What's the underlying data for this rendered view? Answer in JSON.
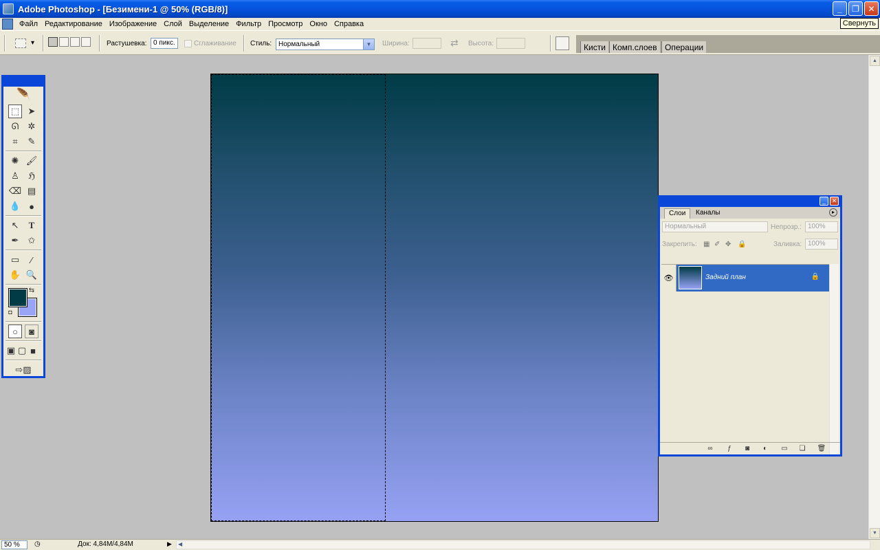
{
  "window": {
    "title": "Adobe Photoshop - [Безимени-1 @ 50% (RGB/8)]",
    "minimize_glyph": "_",
    "restore_glyph": "❐",
    "close_glyph": "✕",
    "tooltip": "Свернуть"
  },
  "menu": [
    "Файл",
    "Редактирование",
    "Изображение",
    "Слой",
    "Выделение",
    "Фильтр",
    "Просмотр",
    "Окно",
    "Справка"
  ],
  "options": {
    "feather_label": "Растушевка:",
    "feather_value": "0 пикс.",
    "antialias_label": "Сглаживание",
    "style_label": "Стиль:",
    "style_value": "Нормальный",
    "width_label": "Ширина:",
    "height_label": "Высота:",
    "swap_glyph": "⇄",
    "palette_tabs": [
      "Кисти",
      "Комп.слоев",
      "Операции"
    ]
  },
  "colors": {
    "foreground": "#003b46",
    "background": "#9aa5f5",
    "selection_highlight": "#316ac5"
  },
  "layers": {
    "tabs": [
      "Слои",
      "Каналы"
    ],
    "menu_glyph": "▸",
    "blend_mode": "Нормальный",
    "opacity_label": "Непрозр.:",
    "opacity_value": "100%",
    "lock_label": "Закрепить:",
    "fill_label": "Заливка:",
    "fill_value": "100%",
    "items": [
      {
        "name": "Задний план",
        "visible": true,
        "locked": true
      }
    ]
  },
  "status": {
    "zoom": "50 %",
    "doc_info": "Док: 4,84M/4,84M"
  }
}
